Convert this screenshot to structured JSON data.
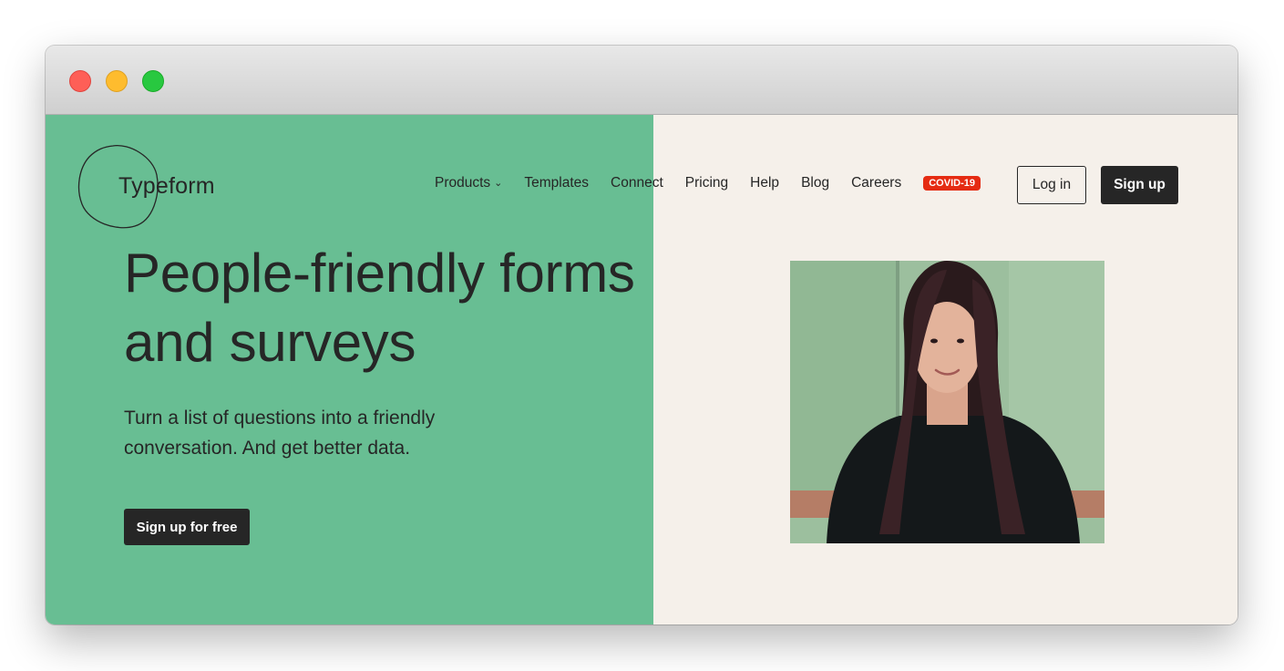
{
  "window": {
    "controls": [
      "close",
      "minimize",
      "zoom"
    ]
  },
  "brand": {
    "logo_text": "Typeform"
  },
  "nav": {
    "products": "Products",
    "templates": "Templates",
    "connect": "Connect",
    "pricing": "Pricing",
    "help": "Help",
    "blog": "Blog",
    "careers": "Careers",
    "covid_badge": "COVID-19"
  },
  "auth": {
    "login_label": "Log in",
    "signup_label": "Sign up"
  },
  "hero": {
    "headline_line1": "People-friendly forms",
    "headline_line2": "and surveys",
    "subhead_line1": "Turn a list of questions into a friendly",
    "subhead_line2": "conversation. And get better data.",
    "cta_label": "Sign up for free"
  },
  "colors": {
    "hero_green": "#68be93",
    "page_background": "#f5f0ea",
    "text_dark": "#262626",
    "covid_red": "#e52b12"
  },
  "icons": {
    "products_dropdown": "chevron-down-icon",
    "logo_mark": "hand-drawn-circle-logo"
  }
}
